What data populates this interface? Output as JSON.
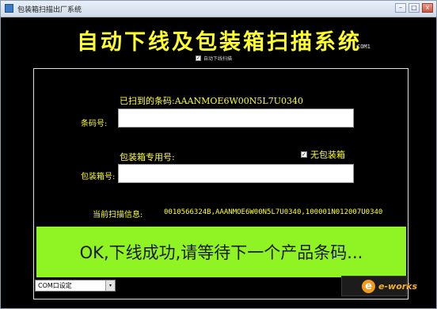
{
  "window": {
    "title": "包装箱扫描出厂系统",
    "controls": {
      "minimize": "–",
      "maximize": "□",
      "close": "x"
    }
  },
  "header": {
    "title": "自动下线及包装箱扫描系统",
    "com_tag": "COM1",
    "auto_offline": {
      "label": "自动下线扫描",
      "checked": true
    }
  },
  "form": {
    "scanned_barcode_text": "已扫到的条码:AAANMOE6W00N5L7U0340",
    "barcode_label": "条码号:",
    "barcode_value": "",
    "box_dedicated_label": "包装箱专用号:",
    "no_packing": {
      "label": "无包装箱",
      "checked": true
    },
    "box_label": "包装箱号:",
    "box_value": "",
    "current_scan_label": "当前扫描信息:",
    "current_scan_value": "0010566324B,AAANMOE6W00N5L7U0340,100001N012007U0340"
  },
  "status": {
    "message": "OK,下线成功,请等待下一个产品条码...",
    "color": "#90f323"
  },
  "bottom": {
    "com_select": "COM口设定",
    "select_arrow": "▾"
  },
  "watermark": {
    "letter": "e",
    "text": "e-works"
  },
  "colors": {
    "accent": "#ffff2a",
    "background": "#000000"
  }
}
